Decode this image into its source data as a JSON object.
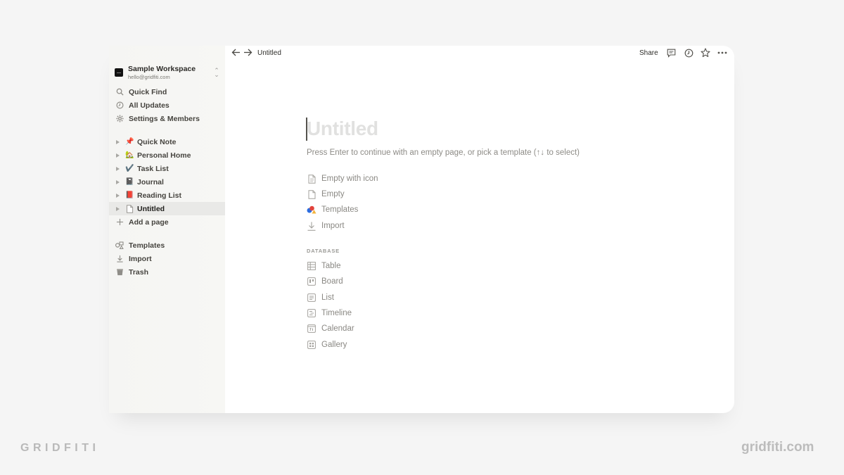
{
  "workspace": {
    "name": "Sample Workspace",
    "email": "hello@gridfiti.com"
  },
  "sidebar": {
    "nav": [
      {
        "label": "Quick Find",
        "icon": "search-icon"
      },
      {
        "label": "All Updates",
        "icon": "clock-icon"
      },
      {
        "label": "Settings & Members",
        "icon": "gear-icon"
      }
    ],
    "pages": [
      {
        "label": "Quick Note",
        "emoji": "📌"
      },
      {
        "label": "Personal Home",
        "emoji": "🏡"
      },
      {
        "label": "Task List",
        "emoji": "✔️"
      },
      {
        "label": "Journal",
        "emoji": "📓"
      },
      {
        "label": "Reading List",
        "emoji": "📕"
      },
      {
        "label": "Untitled",
        "emoji": "page-icon",
        "active": true
      }
    ],
    "add_page": "Add a page",
    "bottom": [
      {
        "label": "Templates",
        "icon": "templates-icon"
      },
      {
        "label": "Import",
        "icon": "import-icon"
      },
      {
        "label": "Trash",
        "icon": "trash-icon"
      }
    ]
  },
  "topbar": {
    "breadcrumb": "Untitled",
    "share": "Share"
  },
  "page": {
    "title_placeholder": "Untitled",
    "hint": "Press Enter to continue with an empty page, or pick a template (↑↓ to select)",
    "options": [
      {
        "label": "Empty with icon",
        "icon": "page-with-icon-icon"
      },
      {
        "label": "Empty",
        "icon": "page-icon"
      },
      {
        "label": "Templates",
        "icon": "templates-icon"
      },
      {
        "label": "Import",
        "icon": "import-icon"
      }
    ],
    "database_heading": "DATABASE",
    "database": [
      {
        "label": "Table",
        "icon": "table-icon"
      },
      {
        "label": "Board",
        "icon": "board-icon"
      },
      {
        "label": "List",
        "icon": "list-icon"
      },
      {
        "label": "Timeline",
        "icon": "timeline-icon"
      },
      {
        "label": "Calendar",
        "icon": "calendar-icon"
      },
      {
        "label": "Gallery",
        "icon": "gallery-icon"
      }
    ]
  },
  "branding": {
    "left": "GRIDFITI",
    "right": "gridfiti.com"
  }
}
